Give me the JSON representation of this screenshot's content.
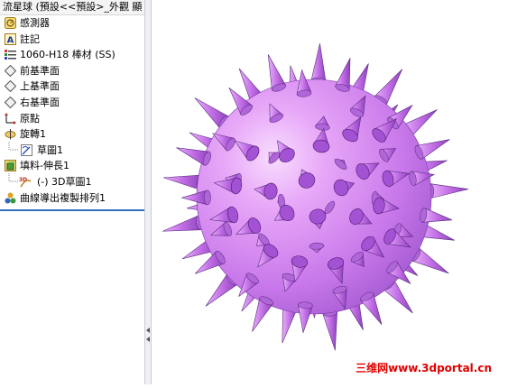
{
  "window_title": "流星球 (預設<<預設>_外觀 顯",
  "tree": [
    {
      "label": "感測器",
      "icon": "sensor-icon"
    },
    {
      "label": "註記",
      "icon": "annotation-icon"
    },
    {
      "label": "1060-H18 棒材 (SS)",
      "icon": "material-icon"
    },
    {
      "label": "前基準面",
      "icon": "plane-icon"
    },
    {
      "label": "上基準面",
      "icon": "plane-icon"
    },
    {
      "label": "右基準面",
      "icon": "plane-icon"
    },
    {
      "label": "原點",
      "icon": "origin-icon"
    },
    {
      "label": "旋轉1",
      "icon": "revolve-icon"
    },
    {
      "label": "草圖1",
      "icon": "sketch-icon"
    },
    {
      "label": "填料-伸長1",
      "icon": "extrude-icon"
    },
    {
      "label": "(-) 3D草圖1",
      "icon": "3d-sketch-icon"
    },
    {
      "label": "曲線導出複製排列1",
      "icon": "curve-pattern-icon"
    }
  ],
  "watermark": "三维网www.3dportal.cn",
  "colors": {
    "accent": "#2f6fc4",
    "model": "#c77ae8"
  }
}
